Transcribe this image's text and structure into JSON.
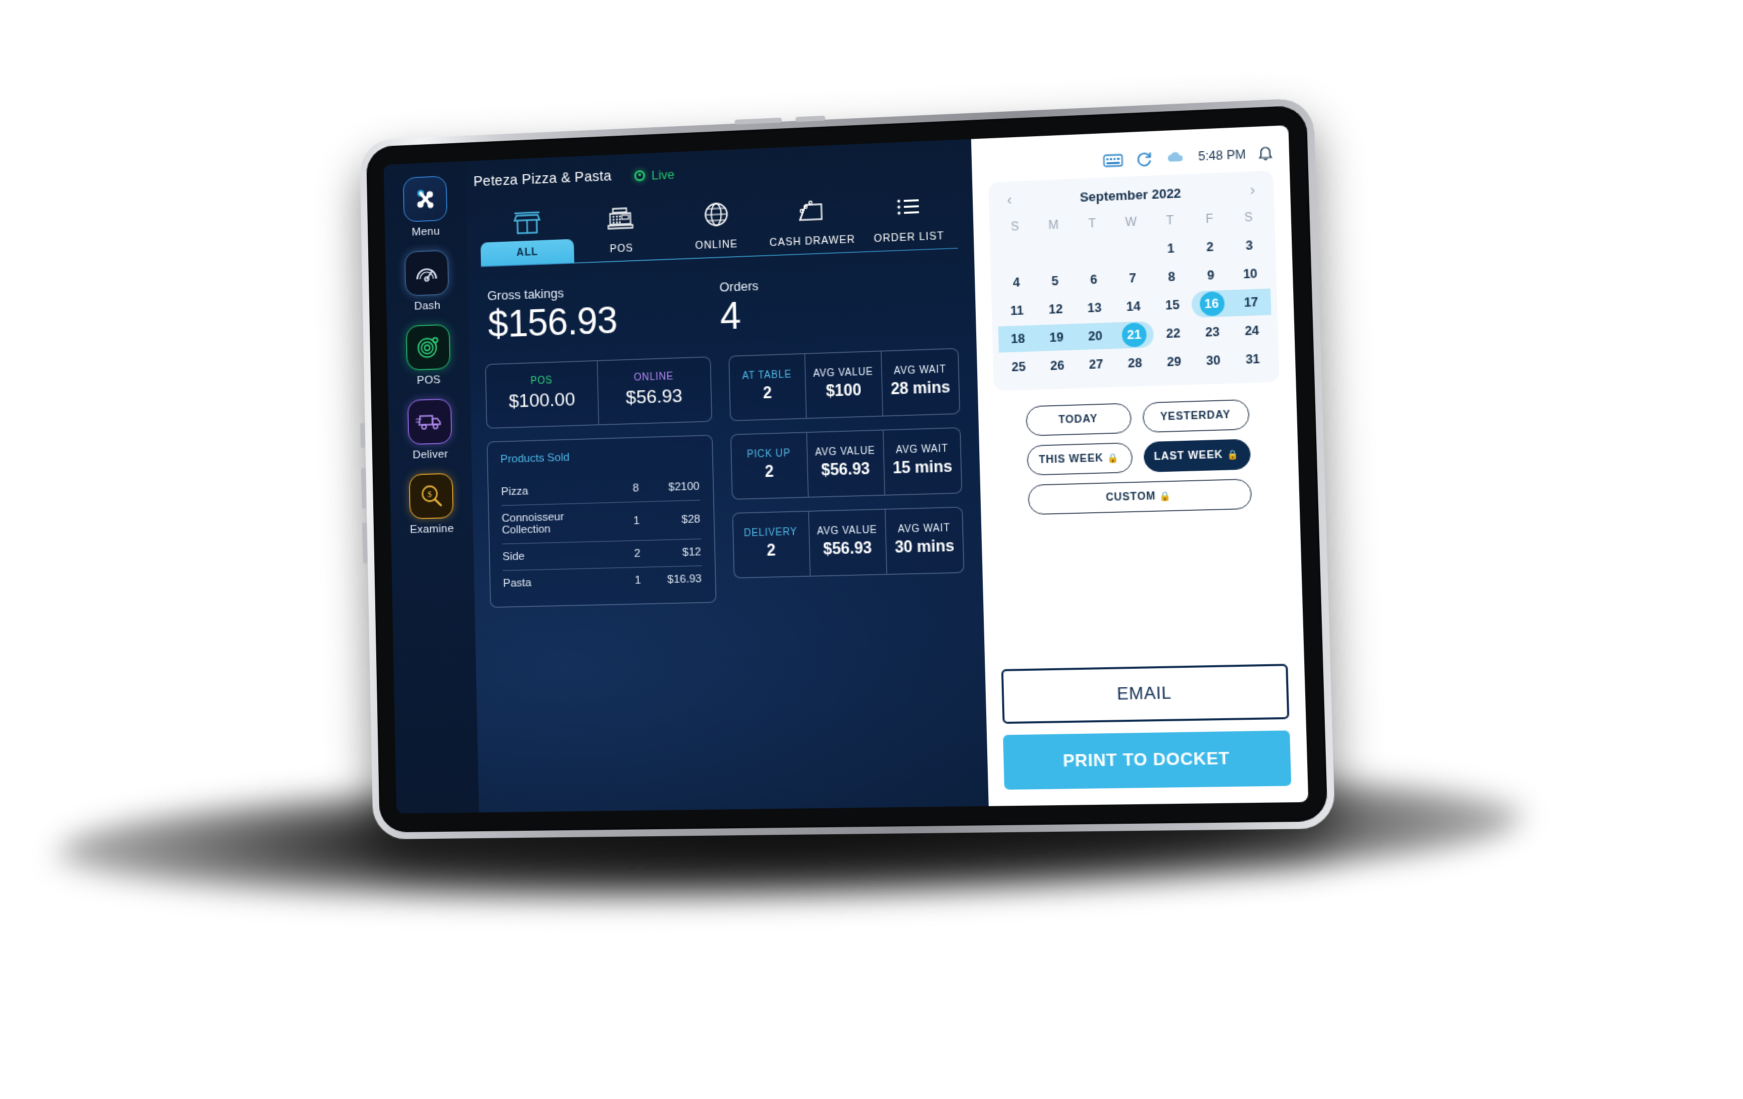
{
  "header": {
    "store_name": "Peteza Pizza & Pasta",
    "status_label": "Live",
    "time": "5:48 PM",
    "icons": [
      "keyboard-icon",
      "sync-icon",
      "cloud-icon",
      "bell-icon"
    ]
  },
  "sidebar": {
    "items": [
      {
        "label": "Menu",
        "icon": "menu-logo-icon"
      },
      {
        "label": "Dash",
        "icon": "gauge-icon"
      },
      {
        "label": "POS",
        "icon": "pos-target-icon"
      },
      {
        "label": "Deliver",
        "icon": "delivery-van-icon"
      },
      {
        "label": "Examine",
        "icon": "magnifier-dollar-icon"
      }
    ]
  },
  "tabs": [
    {
      "label": "ALL",
      "icon": "storefront-icon",
      "active": true
    },
    {
      "label": "POS",
      "icon": "cash-register-icon",
      "active": false
    },
    {
      "label": "ONLINE",
      "icon": "globe-icon",
      "active": false
    },
    {
      "label": "CASH DRAWER",
      "icon": "cash-drawer-icon",
      "active": false
    },
    {
      "label": "ORDER LIST",
      "icon": "list-icon",
      "active": false
    }
  ],
  "kpis": {
    "gross_label": "Gross takings",
    "gross_value": "$156.93",
    "orders_label": "Orders",
    "orders_value": "4"
  },
  "channel_card": {
    "pos_label": "POS",
    "pos_value": "$100.00",
    "pos_color": "#2fd07a",
    "online_label": "ONLINE",
    "online_value": "$56.93",
    "online_color": "#b887f5"
  },
  "products": {
    "title": "Products Sold",
    "rows": [
      {
        "name": "Pizza",
        "qty": "8",
        "amount": "$2100"
      },
      {
        "name": "Connoisseur Collection",
        "qty": "1",
        "amount": "$28"
      },
      {
        "name": "Side",
        "qty": "2",
        "amount": "$12"
      },
      {
        "name": "Pasta",
        "qty": "1",
        "amount": "$16.93"
      }
    ]
  },
  "order_types": [
    {
      "type_label": "AT TABLE",
      "type_value": "2",
      "avg_value_label": "AVG VALUE",
      "avg_value": "$100",
      "avg_wait_label": "AVG WAIT",
      "avg_wait": "28 mins"
    },
    {
      "type_label": "PICK UP",
      "type_value": "2",
      "avg_value_label": "AVG VALUE",
      "avg_value": "$56.93",
      "avg_wait_label": "AVG WAIT",
      "avg_wait": "15 mins"
    },
    {
      "type_label": "DELIVERY",
      "type_value": "2",
      "avg_value_label": "AVG VALUE",
      "avg_value": "$56.93",
      "avg_wait_label": "AVG WAIT",
      "avg_wait": "30 mins"
    }
  ],
  "calendar": {
    "month_title": "September 2022",
    "prev_icon": "chevron-left-icon",
    "next_icon": "chevron-right-icon",
    "dow": [
      "S",
      "M",
      "T",
      "W",
      "T",
      "F",
      "S"
    ],
    "leading_blanks": 4,
    "days": [
      1,
      2,
      3,
      4,
      5,
      6,
      7,
      8,
      9,
      10,
      11,
      12,
      13,
      14,
      15,
      16,
      17,
      18,
      19,
      20,
      21,
      22,
      23,
      24,
      25,
      26,
      27,
      28,
      29,
      30,
      31
    ],
    "range_start": 16,
    "range_end": 21,
    "accent": "#29b6e8",
    "range_fill": "#b9e6f8"
  },
  "date_chips": [
    {
      "label": "TODAY",
      "active": false,
      "locked": false
    },
    {
      "label": "YESTERDAY",
      "active": false,
      "locked": false
    },
    {
      "label": "THIS WEEK",
      "active": false,
      "locked": true
    },
    {
      "label": "LAST WEEK",
      "active": true,
      "locked": true
    },
    {
      "label": "CUSTOM",
      "active": false,
      "locked": true
    }
  ],
  "actions": {
    "email_label": "EMAIL",
    "print_label": "PRINT TO DOCKET",
    "print_color": "#3cb9e8"
  }
}
